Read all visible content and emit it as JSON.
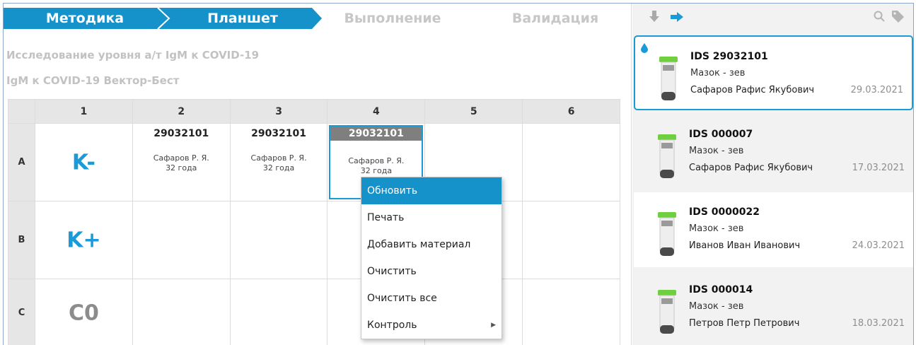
{
  "steps": [
    "Методика",
    "Планшет",
    "Выполнение",
    "Валидация"
  ],
  "method_title": "Исследование уровня а/т IgM к COVID-19",
  "kit_title": "IgM к COVID-19 Вектор-Бест",
  "grid": {
    "columns": [
      "1",
      "2",
      "3",
      "4",
      "5",
      "6"
    ],
    "rows": [
      "A",
      "B",
      "C"
    ],
    "controls": {
      "A": "K-",
      "B": "K+",
      "C": "C0"
    },
    "samples": [
      {
        "id": "29032101",
        "name": "Сафаров Р. Я.",
        "age": "32 года"
      },
      {
        "id": "29032101",
        "name": "Сафаров Р. Я.",
        "age": "32 года"
      },
      {
        "id": "29032101",
        "name": "Сафаров Р. Я.",
        "age": "32 года"
      }
    ]
  },
  "context_menu": [
    "Обновить",
    "Печать",
    "Добавить материал",
    "Очистить",
    "Очистить все",
    "Контроль"
  ],
  "toolbar_icons": [
    "arrow-down-icon",
    "arrow-right-icon",
    "search-icon",
    "tag-icon"
  ],
  "samples_list": [
    {
      "id": "IDS 29032101",
      "material": "Мазок - зев",
      "patient": "Сафаров Рафис Якубович",
      "date": "29.03.2021"
    },
    {
      "id": "IDS 000007",
      "material": "Мазок - зев",
      "patient": "Сафаров Рафис Якубович",
      "date": "17.03.2021"
    },
    {
      "id": "IDS 0000022",
      "material": "Мазок - зев",
      "patient": "Иванов Иван Иванович",
      "date": "24.03.2021"
    },
    {
      "id": "IDS 000014",
      "material": "Мазок - зев",
      "patient": "Петров Петр Петрович",
      "date": "18.03.2021"
    }
  ],
  "colors": {
    "accent": "#1a9ad6",
    "step_active": "#1592c9",
    "control_gray": "#8c8c8c",
    "tube_cap": "#6fcf3f"
  }
}
